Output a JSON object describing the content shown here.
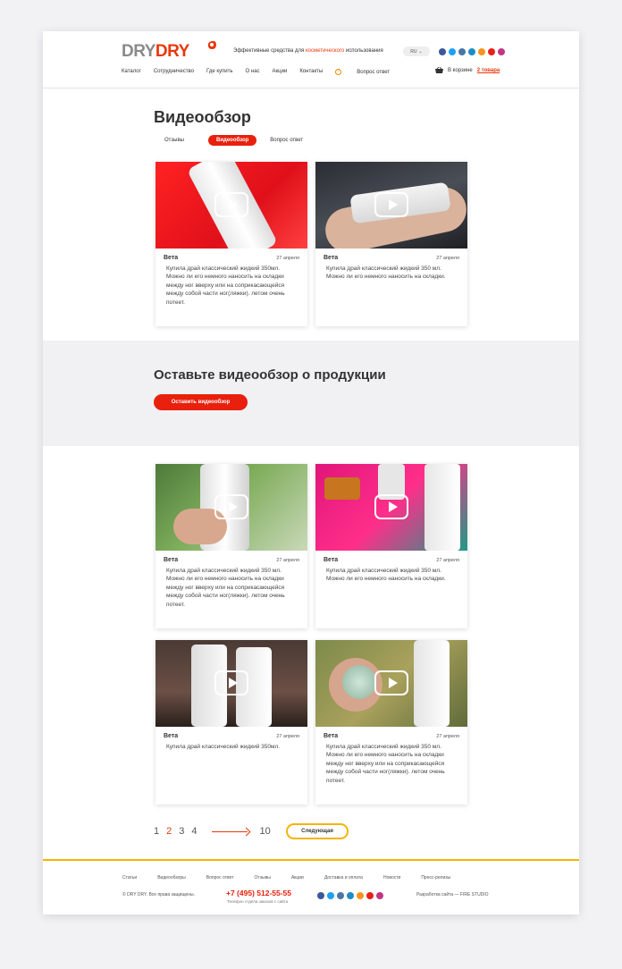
{
  "header": {
    "logo_dry1": "DRY",
    "logo_dry2": "DRY",
    "tagline_pre": "Эффективные средства для ",
    "tagline_hl": "косметического",
    "tagline_post": " использования",
    "lang": "RU",
    "nav": [
      "Каталог",
      "Сотрудничество",
      "Где купить",
      "О нас",
      "Акции",
      "Контакты",
      "Вопрос ответ"
    ],
    "cart_label": "В корзине",
    "cart_count": "2 товара"
  },
  "page_title": "Видеообзор",
  "tabs": [
    "Отзывы",
    "Видеообзор",
    "Вопрос ответ"
  ],
  "cards": [
    {
      "name": "Вета",
      "date": "27 апреля",
      "text": "Купила драй классический жидкий 350мл. Можно ли его немного наносить на складки между ног вверху или на соприкасающейся между собой части ног(ляжки). летом очень потеет."
    },
    {
      "name": "Вета",
      "date": "27 апреля",
      "text": "Купила драй классический жидкий 350 мл. Можно ли его немного наносить на складки."
    },
    {
      "name": "Вета",
      "date": "27 апреля",
      "text": "Купила драй классический жидкий 350 мл. Можно ли его немного наносить на складки между ног вверху или на соприкасающейся между собой части ног(ляжки). летом очень потеет."
    },
    {
      "name": "Вета",
      "date": "27 апреля",
      "text": "Купила драй классический жидкий 350 мл. Можно ли его немного наносить на складки."
    },
    {
      "name": "Вета",
      "date": "27 апреля",
      "text": "Купила драй классический жидкий 350мл."
    },
    {
      "name": "Вета",
      "date": "27 апреля",
      "text": "Купила драй классический жидкий 350 мл. Можно ли его немного наносить на складки между ног вверху или на соприкасающейся между собой части ног(ляжки). летом очень потеет."
    }
  ],
  "band": {
    "title": "Оставьте видеообзор о продукции",
    "button": "Оставить видеообзор"
  },
  "pagination": {
    "pages": [
      "1",
      "2",
      "3",
      "4"
    ],
    "last": "10",
    "next": "Следующая"
  },
  "footer": {
    "links": [
      "Статьи",
      "Видеообзоры",
      "Вопрос ответ",
      "Отзывы",
      "Акции",
      "Доставка и оплата",
      "Новости",
      "Пресс-релизы"
    ],
    "copyright": "© DRY DRY. Все права защищены.",
    "phone": "+7 (495) 512-55-55",
    "phone_sub": "Телефон отдела заказов с сайта",
    "developer": "Разработка сайта — FIRE STUDIO"
  },
  "colors": {
    "brand_red": "#e8200d",
    "accent_yellow": "#f4b400",
    "logo_gray": "#8a8a8a"
  },
  "social_icons": [
    "facebook-icon",
    "twitter-icon",
    "vk-icon",
    "livejournal-icon",
    "odnoklassniki-icon",
    "youtube-icon",
    "instagram-icon"
  ]
}
